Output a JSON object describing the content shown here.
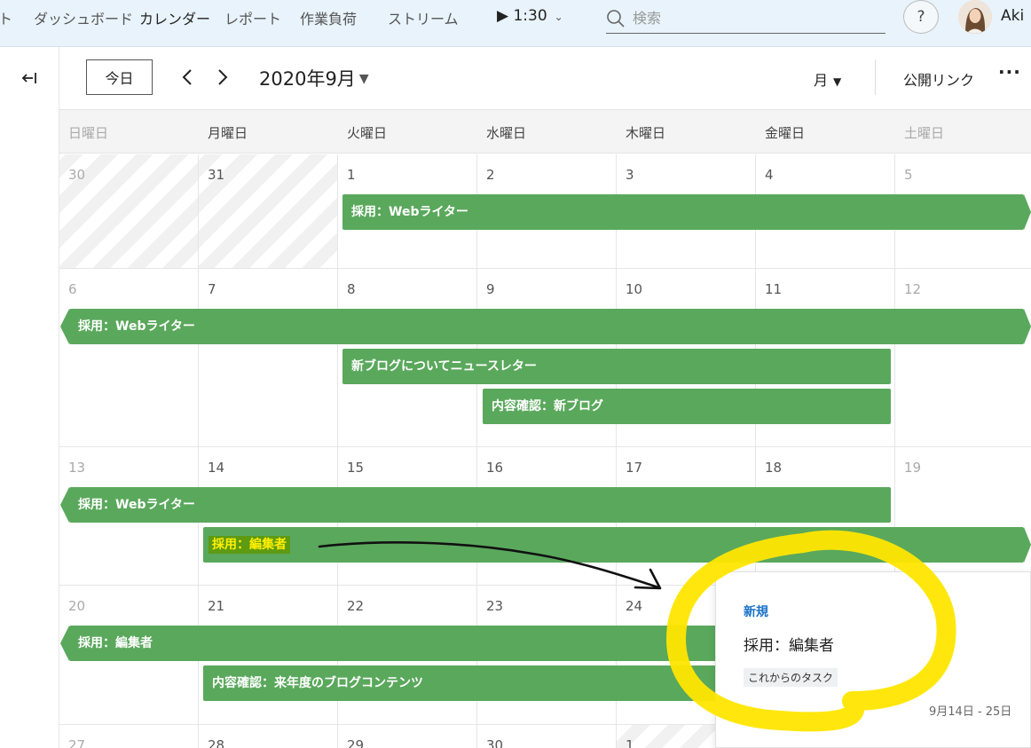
{
  "topnav": {
    "items": [
      "ト",
      "ダッシュボード",
      "カレンダー",
      "レポート",
      "作業負荷",
      "ストリーム"
    ],
    "active_index": 2,
    "timer": "1:30",
    "search_placeholder": "検索",
    "help": "?",
    "user": "Aki"
  },
  "toolbar": {
    "today": "今日",
    "month": "2020年9月",
    "view": "月",
    "public_link": "公開リンク",
    "more": "···"
  },
  "calendar": {
    "weekdays": [
      "日曜日",
      "月曜日",
      "火曜日",
      "水曜日",
      "木曜日",
      "金曜日",
      "土曜日"
    ],
    "weeks": [
      {
        "days": [
          "30",
          "31",
          "1",
          "2",
          "3",
          "4",
          "5"
        ],
        "events": [
          {
            "label": "採用：Webライター"
          }
        ]
      },
      {
        "days": [
          "6",
          "7",
          "8",
          "9",
          "10",
          "11",
          "12"
        ],
        "events": [
          {
            "label": "採用：Webライター"
          },
          {
            "label": "新ブログについてニュースレター"
          },
          {
            "label": "内容確認：新ブログ"
          }
        ]
      },
      {
        "days": [
          "13",
          "14",
          "15",
          "16",
          "17",
          "18",
          "19"
        ],
        "events": [
          {
            "label": "採用：Webライター"
          },
          {
            "label": "採用：編集者"
          }
        ]
      },
      {
        "days": [
          "20",
          "21",
          "22",
          "23",
          "24",
          "",
          ""
        ],
        "events": [
          {
            "label": "採用：編集者"
          },
          {
            "label": "内容確認：来年度のブログコンテンツ"
          }
        ]
      },
      {
        "days": [
          "27",
          "28",
          "29",
          "30",
          "1",
          "",
          ""
        ]
      }
    ]
  },
  "popup": {
    "status": "新規",
    "title": "採用：編集者",
    "tag": "これからのタスク",
    "dates": "9月14日 - 25日"
  },
  "colors": {
    "event_green": "#5aa85c",
    "highlight_yellow": "#ffe600",
    "status_blue": "#1a73c9",
    "nav_bg": "#e8f3fb"
  }
}
